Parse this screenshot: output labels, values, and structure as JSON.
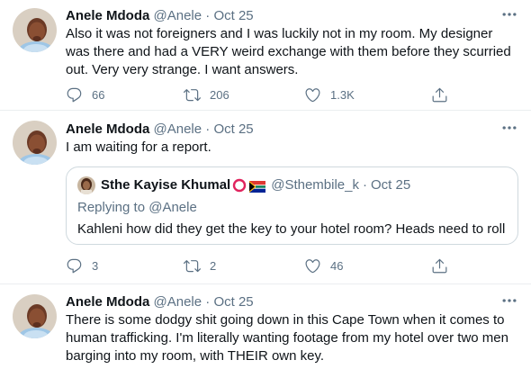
{
  "tweets": [
    {
      "name": "Anele Mdoda",
      "handle": "@Anele",
      "separator": "·",
      "date": "Oct 25",
      "text": "Also it was not foreigners and I was luckily not in my room. My designer was there and had a VERY weird exchange with them before they scurried out. Very very strange. I want answers.",
      "replies": "66",
      "retweets": "206",
      "likes": "1.3K"
    },
    {
      "name": "Anele Mdoda",
      "handle": "@Anele",
      "separator": "·",
      "date": "Oct 25",
      "text": "I am waiting for a report.",
      "quote": {
        "name": "Sthe Kayise Khumal",
        "handle": "@Sthembile_k",
        "separator": "·",
        "date": "Oct 25",
        "replying_to": "Replying to @Anele",
        "text": "Kahleni how did they get the key to your hotel room? Heads need to roll"
      },
      "replies": "3",
      "retweets": "2",
      "likes": "46"
    },
    {
      "name": "Anele Mdoda",
      "handle": "@Anele",
      "separator": "·",
      "date": "Oct 25",
      "text": "There is some dodgy shit going down in this Cape Town when it comes to human trafficking. I'm literally wanting footage from my hotel over two men barging into my room, with THEIR own key."
    }
  ],
  "icons": {
    "reply": "reply-icon",
    "retweet": "retweet-icon",
    "like": "heart-icon",
    "share": "share-icon",
    "more": "more-icon"
  },
  "colors": {
    "text": "#0f1419",
    "secondary": "#5b7083",
    "border": "#ebeef0"
  }
}
